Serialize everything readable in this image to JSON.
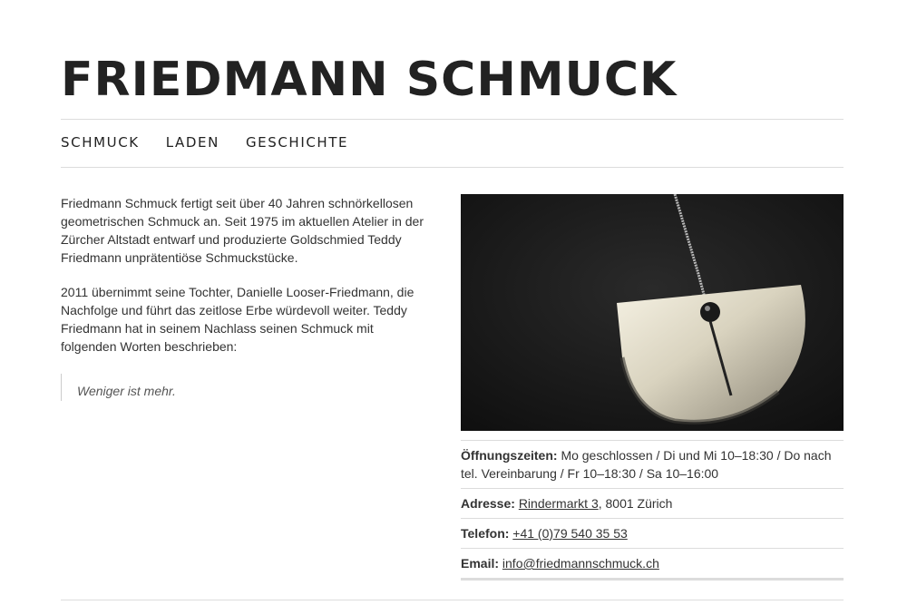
{
  "site": {
    "title": "FRIEDMANN SCHMUCK"
  },
  "nav": {
    "items": [
      {
        "label": "SCHMUCK"
      },
      {
        "label": "LADEN"
      },
      {
        "label": "GESCHICHTE"
      }
    ]
  },
  "intro": {
    "paragraph1": "Friedmann Schmuck fertigt seit über 40 Jahren schnörkellosen geometrischen Schmuck an. Seit 1975 im aktuellen Atelier in der Zürcher Altstadt entwarf und produzierte Goldschmied Teddy Friedmann unprätentiöse Schmuckstücke.",
    "paragraph2": "2011 übernimmt seine Tochter, Danielle Looser-Friedmann, die Nachfolge und führt das zeitlose Erbe würdevoll weiter. Teddy Friedmann hat in seinem Nachlass seinen Schmuck mit folgenden Worten beschrieben:",
    "quote": "Weniger ist mehr."
  },
  "info": {
    "hours_label": "Öffnungszeiten:",
    "hours_value": "Mo geschlossen / Di und Mi 10–18:30 / Do nach tel. Vereinbarung / Fr 10–18:30 / Sa 10–16:00",
    "address_label": "Adresse:",
    "address_link": "Rindermarkt 3",
    "address_rest": ", 8001 Zürich",
    "phone_label": "Telefon:",
    "phone_link": "+41 (0)79 540 35 53",
    "email_label": "Email:",
    "email_link": "info@friedmannschmuck.ch"
  }
}
